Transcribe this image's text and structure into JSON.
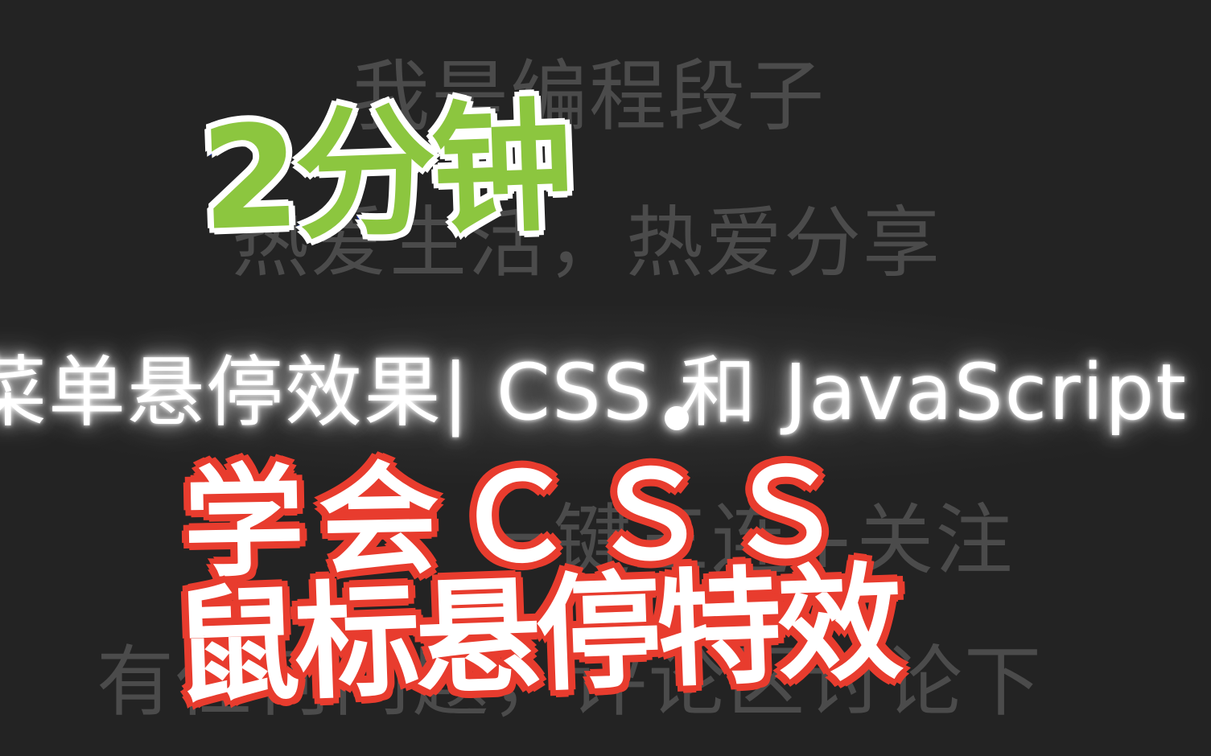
{
  "menu": {
    "items": [
      "我是编程段子",
      "热爱生活，热爱分享",
      "菜单悬停效果| CSS 和 JavaScript",
      "一键三连+关注",
      "有任何问题，评论区讨论下"
    ],
    "hovered_index": 2
  },
  "overlay": {
    "duration_label": "2分钟",
    "title_line1": "学会ＣＳＳ",
    "title_line2": "鼠标悬停特效"
  },
  "colors": {
    "background": "#232323",
    "menu_text": "#4b4b4b",
    "hover_text": "#ffffff",
    "duration_fill": "#8cc63f",
    "duration_outline": "#1f3bb0",
    "title_outline": "#e83c2e"
  },
  "icons": {
    "cursor": "cursor-dot-icon"
  }
}
